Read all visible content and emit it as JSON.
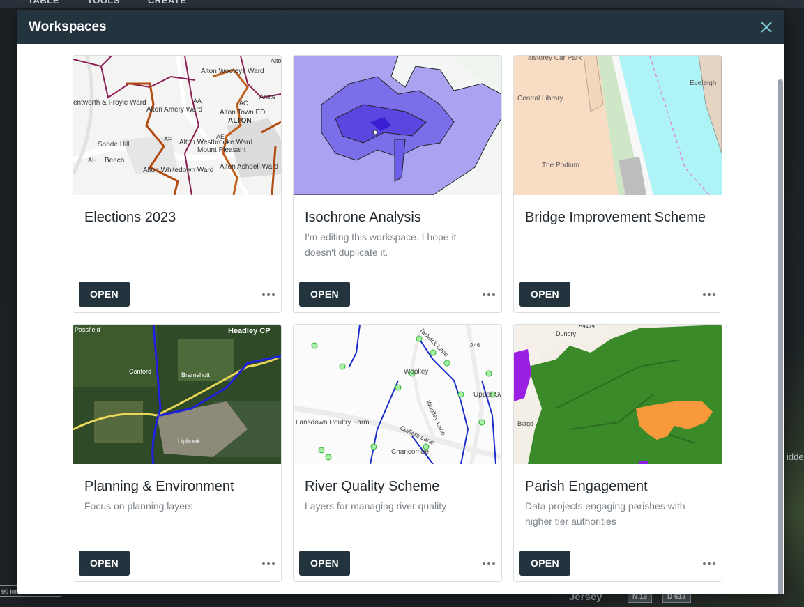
{
  "app": {
    "nav": [
      "TABLE",
      "TOOLS",
      "CREATE"
    ],
    "scale_label": "90 km",
    "map_label_jersey": "Jersey",
    "road_labels": [
      "N 13",
      "D 613"
    ],
    "side_label": "idde"
  },
  "modal": {
    "title": "Workspaces",
    "close_icon": "close-icon",
    "accent_color": "#23343f"
  },
  "cards": [
    {
      "title": "Elections 2023",
      "description": "",
      "open_label": "OPEN",
      "thumb_labels": [
        "Alton Wooteys Ward",
        "entworth & Froyle Ward",
        "Alton Amery Ward",
        "Alton Town ED",
        "ALTON",
        "Alton Westbrooke Ward",
        "Mount Pleasant",
        "Snode Hill",
        "Beech",
        "Alton Whitedown Ward",
        "Alton Ashdell Ward",
        "AA",
        "AC",
        "AE",
        "AF",
        "AH",
        "Alto",
        "Anste"
      ]
    },
    {
      "title": "Isochrone Analysis",
      "description": "I'm editing this workspace. I hope it doesn't duplicate it.",
      "open_label": "OPEN",
      "thumb_labels": []
    },
    {
      "title": "Bridge Improvement Scheme",
      "description": "",
      "open_label": "OPEN",
      "thumb_labels": [
        "Central Library",
        "The Podium",
        "Eveleigh",
        "alstorey Car Park"
      ]
    },
    {
      "title": "Planning & Environment",
      "description": "Focus on planning layers",
      "open_label": "OPEN",
      "thumb_labels": [
        "Headley CP",
        "Bramshott",
        "Liphook",
        "Passfield",
        "Conford"
      ]
    },
    {
      "title": "River Quality Scheme",
      "description": "Layers for managing river quality",
      "open_label": "OPEN",
      "thumb_labels": [
        "Woolley",
        "Lansdown Poultry Farm",
        "Chancombe",
        "Colliers Lane",
        "Woolley Lane",
        "Upper Sw",
        "A46",
        "Tadwick Lane"
      ]
    },
    {
      "title": "Parish Engagement",
      "description": "Data projects engaging parishes with higher tier authorities",
      "open_label": "OPEN",
      "thumb_labels": [
        "A4174",
        "Dundry",
        "Blagdon"
      ]
    }
  ]
}
